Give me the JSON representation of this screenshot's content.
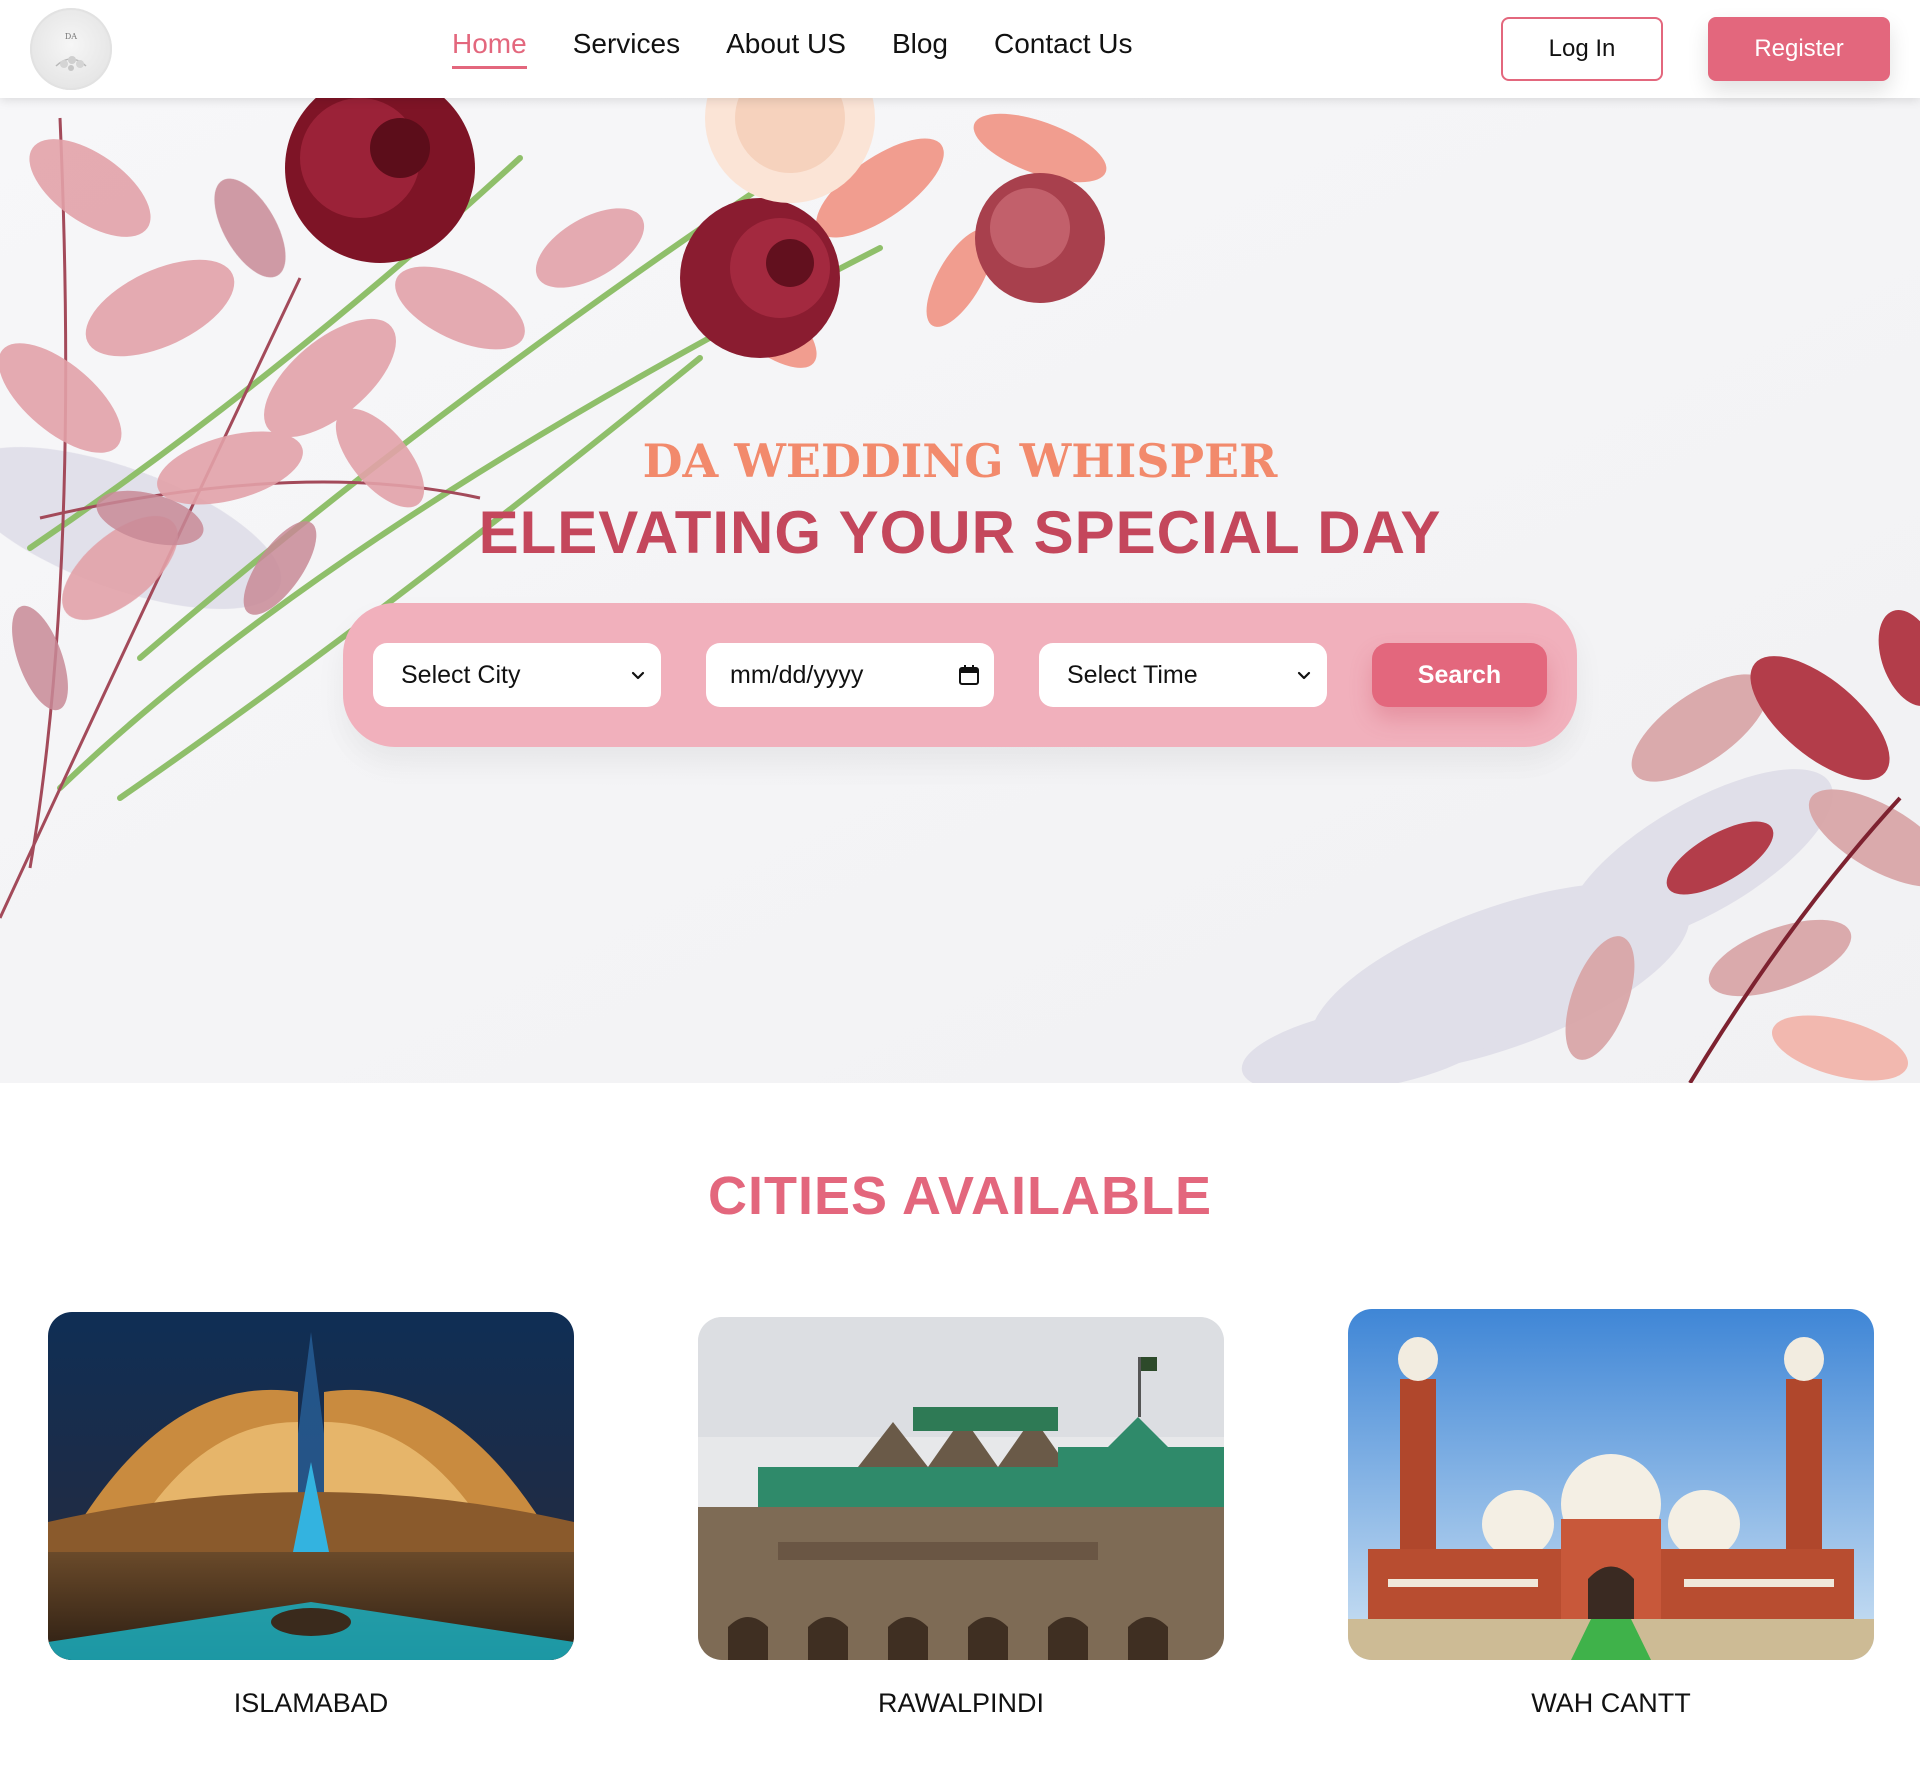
{
  "brand": {
    "logo_text": "DA"
  },
  "nav": {
    "links": [
      {
        "label": "Home",
        "active": true
      },
      {
        "label": "Services"
      },
      {
        "label": "About US"
      },
      {
        "label": "Blog"
      },
      {
        "label": "Contact Us"
      }
    ],
    "login_label": "Log In",
    "register_label": "Register"
  },
  "hero": {
    "subtitle": "DA WEDDING WHISPER",
    "title": "ELEVATING YOUR SPECIAL DAY"
  },
  "search": {
    "city_placeholder": "Select City",
    "date_placeholder": "mm/dd/yyyy",
    "time_placeholder": "Select Time",
    "button_label": "Search"
  },
  "cities": {
    "heading": "CITIES AVAILABLE",
    "items": [
      {
        "name": "ISLAMABAD"
      },
      {
        "name": "RAWALPINDI"
      },
      {
        "name": "WAH CANTT"
      }
    ]
  },
  "colors": {
    "accent": "#e3677d",
    "title": "#c4475c",
    "subtitle": "#f28a6c",
    "search_bar": "#f1b0bc"
  }
}
